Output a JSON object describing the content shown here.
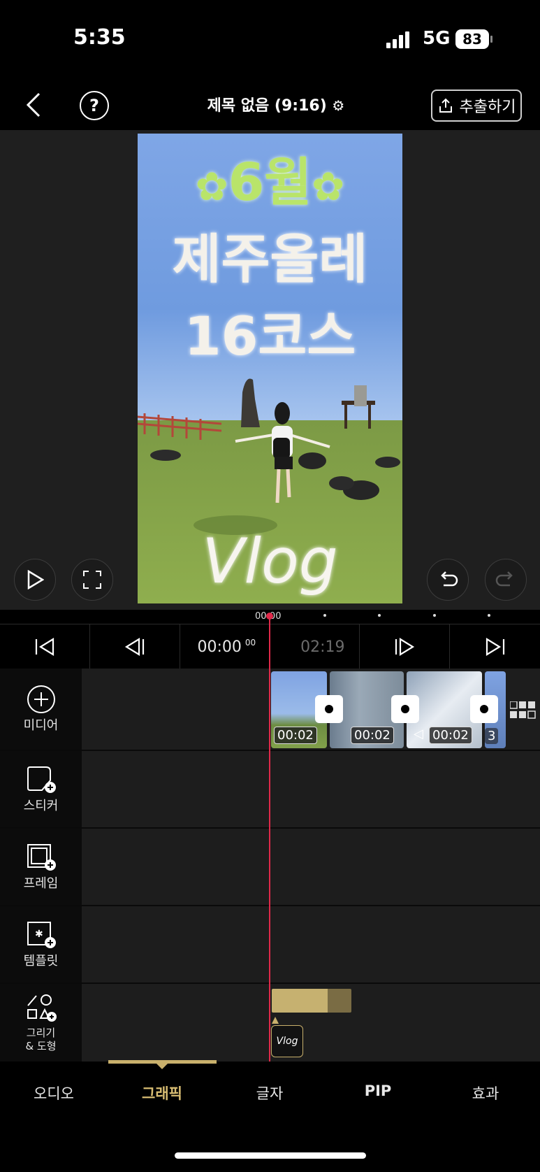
{
  "status": {
    "time": "5:35",
    "network": "5G",
    "battery": "83"
  },
  "header": {
    "title": "제목 없음 (9:16)",
    "export_label": "추출하기"
  },
  "preview": {
    "overlay_lines": [
      "6월",
      "제주올레",
      "16코스"
    ],
    "overlay_bottom": "Vlog"
  },
  "timeline": {
    "ruler_time": "00:00",
    "current_time": "00:00",
    "current_frames": "00",
    "total_time": "02:19"
  },
  "tracks": [
    {
      "label": "미디어",
      "icon": "plus-circle-icon"
    },
    {
      "label": "스티커",
      "icon": "sticker-add-icon"
    },
    {
      "label": "프레임",
      "icon": "frame-add-icon"
    },
    {
      "label": "템플릿",
      "icon": "template-add-icon"
    },
    {
      "label_line1": "그리기",
      "label_line2": "& 도형",
      "icon": "draw-shape-icon"
    }
  ],
  "clips": [
    {
      "duration": "00:02"
    },
    {
      "duration": "00:02"
    },
    {
      "duration": "00:02"
    },
    {
      "duration": "3"
    }
  ],
  "graphic_clip_label": "Vlog",
  "tabs": [
    {
      "label": "오디오"
    },
    {
      "label": "그래픽"
    },
    {
      "label": "글자"
    },
    {
      "label": "PIP"
    },
    {
      "label": "효과"
    }
  ],
  "colors": {
    "accent": "#c9b06c",
    "playhead": "#e0294a",
    "overlay_green": "#b9e46a"
  }
}
